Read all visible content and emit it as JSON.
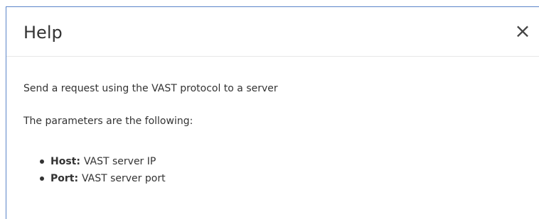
{
  "dialog": {
    "title": "Help",
    "close_label": "×",
    "paragraphs": [
      "Send a request using the VAST protocol to a server",
      "The parameters are the following:"
    ],
    "parameters": [
      {
        "name": "Host:",
        "description": "VAST server IP"
      },
      {
        "name": "Port:",
        "description": "VAST server port"
      }
    ]
  },
  "colors": {
    "border": "#5b85c8",
    "divider": "#e7e7e7",
    "text": "#333333"
  },
  "icons": {
    "close": "close-icon"
  }
}
